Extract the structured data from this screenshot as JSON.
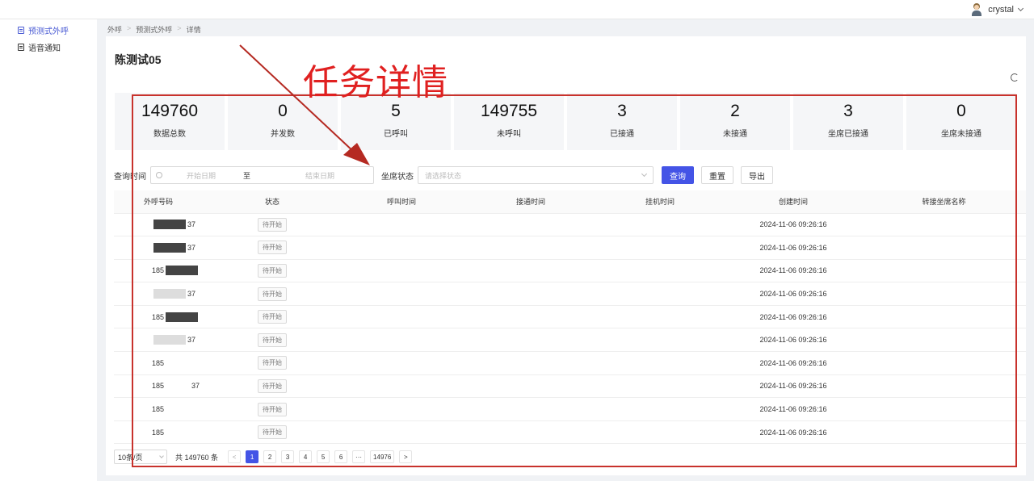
{
  "header": {
    "username": "crystal"
  },
  "sidebar": {
    "items": [
      {
        "label": "预测式外呼",
        "active": true
      },
      {
        "label": "语音通知",
        "active": false
      }
    ]
  },
  "breadcrumb": [
    "外呼",
    "预测式外呼",
    "详情"
  ],
  "task": {
    "title": "陈测试05"
  },
  "annotation": {
    "text": "任务详情",
    "color": "#e02020"
  },
  "stats": [
    {
      "value": "149760",
      "label": "数据总数"
    },
    {
      "value": "0",
      "label": "并发数"
    },
    {
      "value": "5",
      "label": "已呼叫"
    },
    {
      "value": "149755",
      "label": "未呼叫"
    },
    {
      "value": "3",
      "label": "已接通"
    },
    {
      "value": "2",
      "label": "未接通"
    },
    {
      "value": "3",
      "label": "坐席已接通"
    },
    {
      "value": "0",
      "label": "坐席未接通"
    }
  ],
  "filter": {
    "time_label": "查询时间",
    "start_placeholder": "开始日期",
    "to": "至",
    "end_placeholder": "结束日期",
    "status_label": "坐席状态",
    "status_placeholder": "请选择状态",
    "query": "查询",
    "reset": "重置",
    "export": "导出"
  },
  "table": {
    "columns": [
      "外呼号码",
      "状态",
      "呼叫时间",
      "接通时间",
      "挂机时间",
      "创建时间",
      "转接坐席名称"
    ],
    "rows": [
      {
        "prefix": "",
        "suffix": "37",
        "mask": "dark",
        "status": "待开始",
        "created": "2024-11-06 09:26:16"
      },
      {
        "prefix": "",
        "suffix": "37",
        "mask": "dark",
        "status": "待开始",
        "created": "2024-11-06 09:26:16"
      },
      {
        "prefix": "185",
        "suffix": "",
        "mask": "dark",
        "status": "待开始",
        "created": "2024-11-06 09:26:16"
      },
      {
        "prefix": "",
        "suffix": "37",
        "mask": "light",
        "status": "待开始",
        "created": "2024-11-06 09:26:16"
      },
      {
        "prefix": "185",
        "suffix": "",
        "mask": "dark",
        "status": "待开始",
        "created": "2024-11-06 09:26:16"
      },
      {
        "prefix": "",
        "suffix": "37",
        "mask": "light",
        "status": "待开始",
        "created": "2024-11-06 09:26:16"
      },
      {
        "prefix": "185",
        "suffix": "",
        "mask": "none",
        "status": "待开始",
        "created": "2024-11-06 09:26:16"
      },
      {
        "prefix": "185",
        "suffix": "37",
        "mask": "none",
        "status": "待开始",
        "created": "2024-11-06 09:26:16"
      },
      {
        "prefix": "185",
        "suffix": "",
        "mask": "none",
        "status": "待开始",
        "created": "2024-11-06 09:26:16"
      },
      {
        "prefix": "185",
        "suffix": "",
        "mask": "none",
        "status": "待开始",
        "created": "2024-11-06 09:26:16"
      }
    ]
  },
  "pagination": {
    "page_size": "10条/页",
    "total": "共 149760 条",
    "pages": [
      "1",
      "2",
      "3",
      "4",
      "5",
      "6",
      "···",
      "14976"
    ],
    "current": "1"
  }
}
